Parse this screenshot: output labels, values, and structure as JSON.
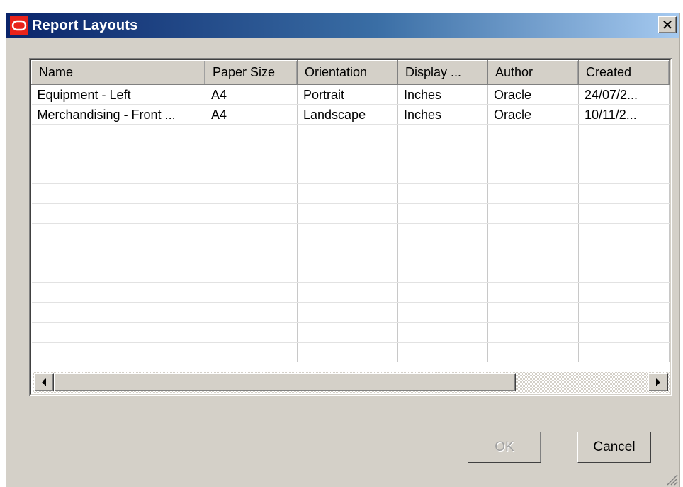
{
  "window": {
    "title": "Report Layouts",
    "close_symbol": "✕",
    "logo_icon": "oracle-logo-icon",
    "title_gradient": [
      "#0a246a",
      "#3a6ea5",
      "#a6caf0"
    ]
  },
  "grid": {
    "columns": [
      "Name",
      "Paper Size",
      "Orientation",
      "Display ...",
      "Author",
      "Created"
    ],
    "rows": [
      [
        "Equipment - Left",
        "A4",
        "Portrait",
        "Inches",
        "Oracle",
        "24/07/2..."
      ],
      [
        "Merchandising - Front ...",
        "A4",
        "Landscape",
        "Inches",
        "Oracle",
        "10/11/2..."
      ],
      [
        "",
        "",
        "",
        "",
        "",
        ""
      ],
      [
        "",
        "",
        "",
        "",
        "",
        ""
      ],
      [
        "",
        "",
        "",
        "",
        "",
        ""
      ],
      [
        "",
        "",
        "",
        "",
        "",
        ""
      ],
      [
        "",
        "",
        "",
        "",
        "",
        ""
      ],
      [
        "",
        "",
        "",
        "",
        "",
        ""
      ],
      [
        "",
        "",
        "",
        "",
        "",
        ""
      ],
      [
        "",
        "",
        "",
        "",
        "",
        ""
      ],
      [
        "",
        "",
        "",
        "",
        "",
        ""
      ],
      [
        "",
        "",
        "",
        "",
        "",
        ""
      ],
      [
        "",
        "",
        "",
        "",
        "",
        ""
      ],
      [
        "",
        "",
        "",
        "",
        "",
        ""
      ]
    ]
  },
  "scrollbar": {
    "left_icon": "arrow-left-icon",
    "right_icon": "arrow-right-icon"
  },
  "buttons": {
    "ok_label": "OK",
    "ok_enabled": false,
    "cancel_label": "Cancel"
  }
}
